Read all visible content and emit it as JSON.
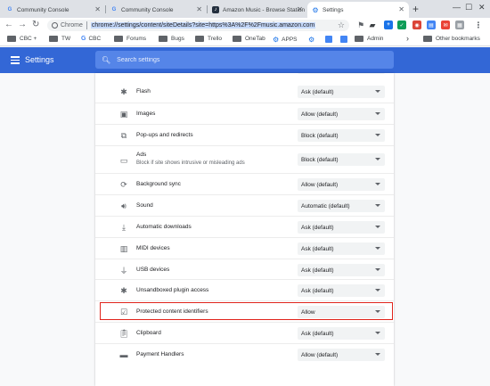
{
  "tabs": [
    {
      "title": "Community Console",
      "favicon": "G"
    },
    {
      "title": "Community Console",
      "favicon": "G"
    },
    {
      "title": "Amazon Music - Browse Station",
      "favicon": "music-icon"
    },
    {
      "title": "Settings",
      "favicon": "gear-icon"
    }
  ],
  "omnibox": {
    "chip": "Chrome",
    "url": "chrome://settings/content/siteDetails?site=https%3A%2F%2Fmusic.amazon.com"
  },
  "bookmarks": [
    {
      "label": "CBC +",
      "type": "folder"
    },
    {
      "label": "TW",
      "type": "folder"
    },
    {
      "label": "CBC",
      "type": "google"
    },
    {
      "label": "Forums",
      "type": "folder"
    },
    {
      "label": "Bugs",
      "type": "folder"
    },
    {
      "label": "Trello",
      "type": "folder"
    },
    {
      "label": "OneTab",
      "type": "folder"
    },
    {
      "label": "APPS",
      "type": "gear"
    },
    {
      "label": "Admin",
      "type": "folder"
    },
    {
      "label": "Other bookmarks",
      "type": "folder"
    }
  ],
  "header": {
    "title": "Settings",
    "search_placeholder": "Search settings"
  },
  "permissions": [
    {
      "label": "Flash",
      "value": "Ask (default)",
      "icon": "puzzle-icon"
    },
    {
      "label": "Images",
      "value": "Allow (default)",
      "icon": "image-icon"
    },
    {
      "label": "Pop-ups and redirects",
      "value": "Block (default)",
      "icon": "popup-icon"
    },
    {
      "label": "Ads",
      "sublabel": "Block if site shows intrusive or misleading ads",
      "value": "Block (default)",
      "icon": "ads-icon"
    },
    {
      "label": "Background sync",
      "value": "Allow (default)",
      "icon": "sync-icon"
    },
    {
      "label": "Sound",
      "value": "Automatic (default)",
      "icon": "sound-icon"
    },
    {
      "label": "Automatic downloads",
      "value": "Ask (default)",
      "icon": "download-icon"
    },
    {
      "label": "MIDI devices",
      "value": "Ask (default)",
      "icon": "midi-icon"
    },
    {
      "label": "USB devices",
      "value": "Ask (default)",
      "icon": "usb-icon"
    },
    {
      "label": "Unsandboxed plugin access",
      "value": "Ask (default)",
      "icon": "puzzle-icon"
    },
    {
      "label": "Protected content identifiers",
      "value": "Allow",
      "icon": "protected-content-icon"
    },
    {
      "label": "Clipboard",
      "value": "Ask (default)",
      "icon": "clipboard-icon"
    },
    {
      "label": "Payment Handlers",
      "value": "Allow (default)",
      "icon": "payment-icon"
    }
  ],
  "colors": {
    "header": "#3367d6",
    "highlight": "#e0241b"
  }
}
